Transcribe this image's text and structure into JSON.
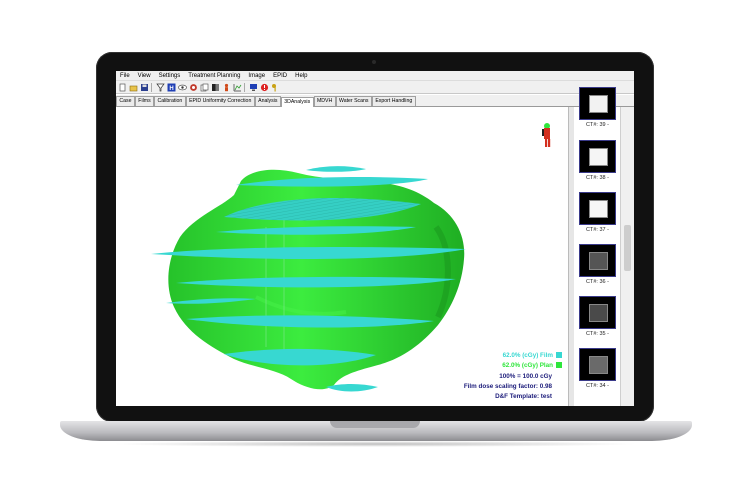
{
  "menu": [
    "File",
    "View",
    "Settings",
    "Treatment Planning",
    "Image",
    "EPID",
    "Help"
  ],
  "toolbar_icons": [
    "new-file-icon",
    "open-folder-icon",
    "save-icon",
    "filter-icon",
    "help-icon",
    "eye-icon",
    "record-icon",
    "copy-icon",
    "contrast-icon",
    "patient-icon",
    "graph-icon",
    "monitor-icon",
    "stop-icon",
    "key-icon"
  ],
  "tabs": [
    "Case",
    "Films",
    "Calibration",
    "EPID Uniformity Correction",
    "Analysis",
    "3DAnalysis",
    "MDVH",
    "Water Scans",
    "Export Handling"
  ],
  "active_tab": "3DAnalysis",
  "legend": {
    "film": "62.0% (cGy) Film",
    "plan": "62.0% (cGy) Plan",
    "reference": "100% = 100.0 cGy",
    "scaling": "Film dose scaling factor: 0.98",
    "template": "D&F Template: test"
  },
  "colors": {
    "film": "#37d8d1",
    "plan": "#2ee63b",
    "legend_text": "#1b1b7a"
  },
  "thumbnails": [
    {
      "label": "CT#: 39 -",
      "tone": "#f2f2f2"
    },
    {
      "label": "CT#: 38 -",
      "tone": "#f5f5f5"
    },
    {
      "label": "CT#: 37 -",
      "tone": "#f7f7f7"
    },
    {
      "label": "CT#: 36 -",
      "tone": "#555555"
    },
    {
      "label": "CT#: 35 -",
      "tone": "#4a4a4a"
    },
    {
      "label": "CT#: 34 -",
      "tone": "#6a6a6a"
    }
  ]
}
